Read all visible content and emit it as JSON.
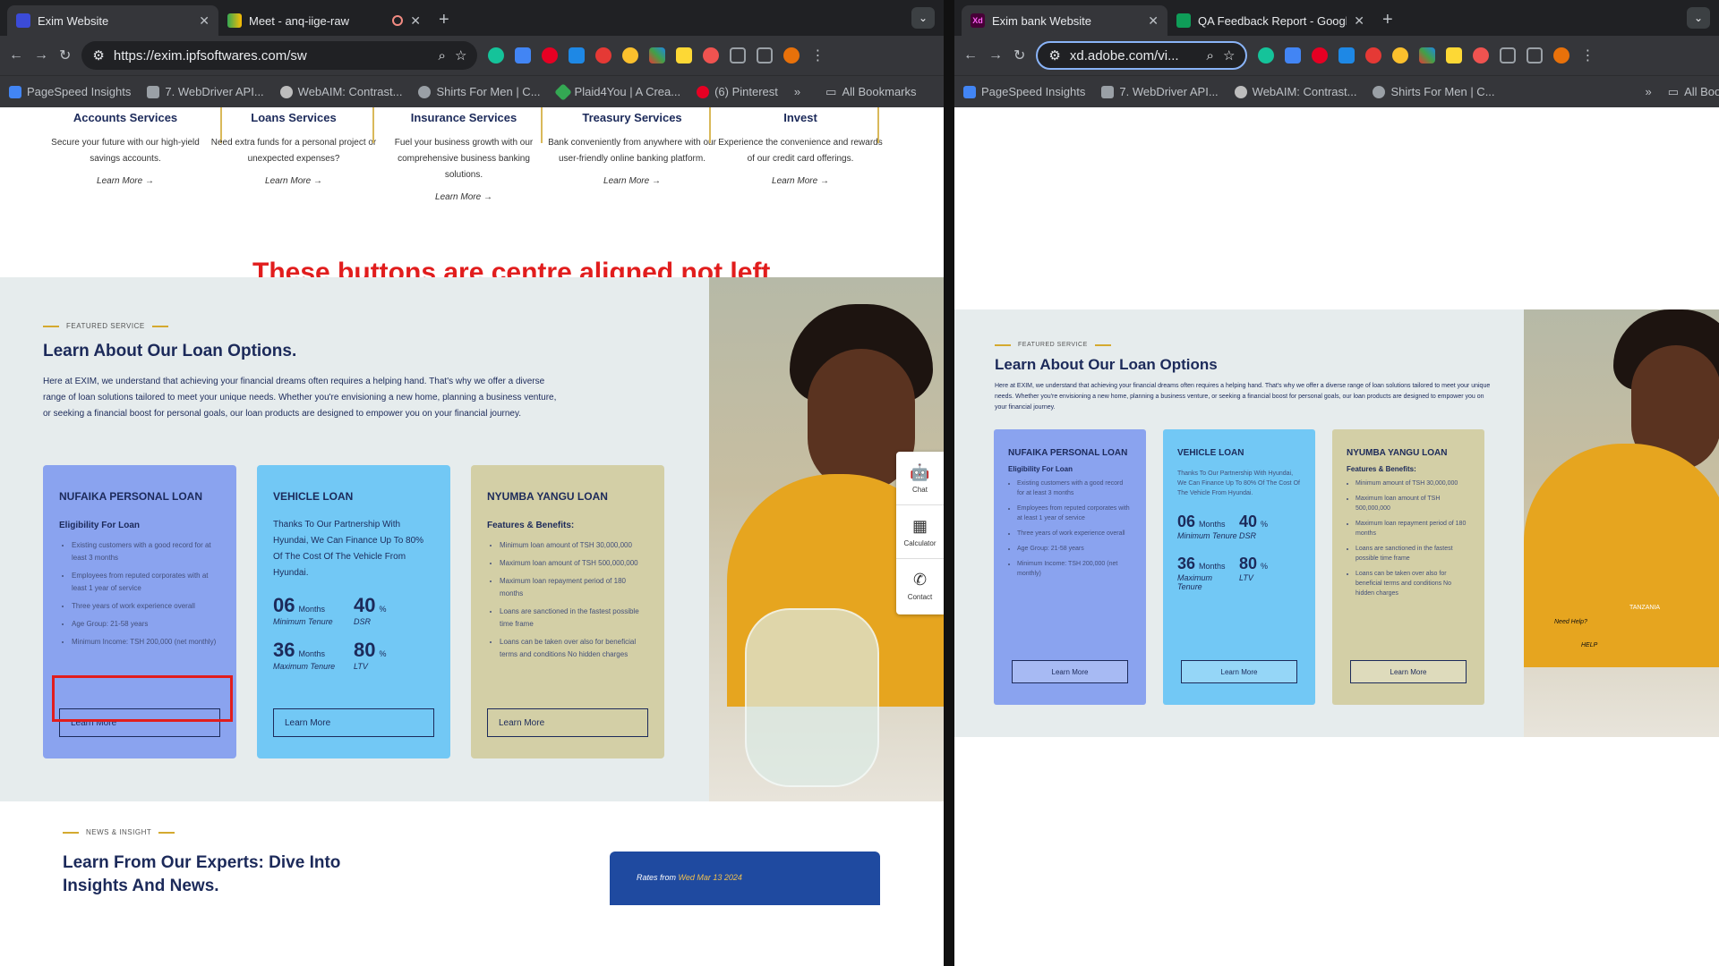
{
  "left_window": {
    "tabs": [
      {
        "title": "Exim Website",
        "active": true
      },
      {
        "title": "Meet - anq-iige-raw",
        "active": false
      }
    ],
    "url": "https://exim.ipfsoftwares.com/sw",
    "bookmarks": [
      "PageSpeed Insights",
      "7. WebDriver API...",
      "WebAIM: Contrast...",
      "Shirts For Men | C...",
      "Plaid4You | A Crea...",
      "(6) Pinterest"
    ],
    "all_bookmarks": "All Bookmarks"
  },
  "right_window": {
    "tabs": [
      {
        "title": "Exim bank Website",
        "active": true
      },
      {
        "title": "QA Feedback Report - Google",
        "active": false
      }
    ],
    "url": "xd.adobe.com/vi...",
    "bookmarks": [
      "PageSpeed Insights",
      "7. WebDriver API...",
      "WebAIM: Contrast...",
      "Shirts For Men | C..."
    ],
    "all_bookmarks": "All Bookmarks"
  },
  "services": [
    {
      "title": "Accounts Services",
      "desc": "Secure your future with our high-yield savings accounts.",
      "link": "Learn More"
    },
    {
      "title": "Loans Services",
      "desc": "Need extra funds for a personal project or unexpected expenses?",
      "link": "Learn More"
    },
    {
      "title": "Insurance Services",
      "desc": "Fuel your business growth with our comprehensive business banking solutions.",
      "link": "Learn More"
    },
    {
      "title": "Treasury Services",
      "desc": "Bank conveniently from anywhere with our user-friendly online banking platform.",
      "link": "Learn More"
    },
    {
      "title": "Invest",
      "desc": "Experience the convenience and rewards of our credit card offerings.",
      "link": "Learn More"
    }
  ],
  "annotation": "These buttons are centre aligned not left",
  "loan_section": {
    "eyebrow": "FEATURED SERVICE",
    "title": "Learn About Our Loan Options.",
    "desc": "Here at EXIM, we understand that achieving your financial dreams often requires a helping hand. That's why we offer a diverse range of loan solutions tailored to meet your unique needs. Whether you're envisioning a new home, planning a business venture, or seeking a financial boost for personal goals, our loan products are designed to empower you on your financial journey.",
    "cards": [
      {
        "title": "NUFAIKA PERSONAL LOAN",
        "subtitle": "Eligibility For Loan",
        "items": [
          "Existing customers with a good record for at least 3 months",
          "Employees from reputed corporates with at least 1 year of service",
          "Three years of work experience overall",
          "Age Group: 21-58 years",
          "Minimum Income: TSH 200,000 (net monthly)"
        ],
        "button": "Learn More"
      },
      {
        "title": "VEHICLE LOAN",
        "body": "Thanks To Our Partnership With Hyundai, We Can Finance Up To 80% Of The Cost Of The Vehicle From Hyundai.",
        "stats": [
          {
            "value": "06",
            "unit": "Months",
            "caption": "Minimum Tenure"
          },
          {
            "value": "40",
            "unit": "%",
            "caption": "DSR"
          },
          {
            "value": "36",
            "unit": "Months",
            "caption": "Maximum Tenure"
          },
          {
            "value": "80",
            "unit": "%",
            "caption": "LTV"
          }
        ],
        "button": "Learn More"
      },
      {
        "title": "NYUMBA YANGU LOAN",
        "subtitle": "Features & Benefits:",
        "items": [
          "Minimum loan amount of TSH 30,000,000",
          "Maximum loan amount of TSH 500,000,000",
          "Maximum loan repayment period of 180 months",
          "Loans are sanctioned in the fastest possible time frame",
          "Loans can be taken over also for beneficial terms and conditions No hidden charges"
        ],
        "button": "Learn More"
      }
    ]
  },
  "widget": {
    "chat": "Chat",
    "calculator": "Calculator",
    "contact": "Contact"
  },
  "news": {
    "eyebrow": "NEWS & INSIGHT",
    "title": "Learn From Our Experts: Dive Into Insights And News.",
    "rates_label": "Rates from",
    "rates_date": "Wed Mar 13 2024"
  },
  "xd": {
    "eyebrow": "FEATURED SERVICE",
    "title": "Learn About Our Loan Options",
    "desc": "Here at EXIM, we understand that achieving your financial dreams often requires a helping hand. That's why we offer a diverse range of loan solutions tailored to meet your unique needs. Whether you're envisioning a new home, planning a business venture, or seeking a financial boost for personal goals, our loan products are designed to empower you on your financial journey.",
    "cards": [
      {
        "title": "NUFAIKA PERSONAL LOAN",
        "subtitle": "Eligibility For Loan",
        "items": [
          "Existing customers with a good record for at least 3 months",
          "Employees from reputed corporates with at least 1 year of service",
          "Three years of work experience overall",
          "Age Group: 21-58 years",
          "Minimum Income: TSH 200,000 (net monthly)"
        ],
        "button": "Learn More"
      },
      {
        "title": "VEHICLE LOAN",
        "body": "Thanks To Our Partnership With Hyundai, We Can Finance Up To 80% Of The Cost Of The Vehicle From Hyundai.",
        "stats": [
          {
            "value": "06",
            "unit": "Months",
            "caption": "Minimum Tenure"
          },
          {
            "value": "40",
            "unit": "%",
            "caption": "DSR"
          },
          {
            "value": "36",
            "unit": "Months",
            "caption": "Maximum Tenure"
          },
          {
            "value": "80",
            "unit": "%",
            "caption": "LTV"
          }
        ],
        "button": "Learn More"
      },
      {
        "title": "NYUMBA YANGU LOAN",
        "subtitle": "Features & Benefits:",
        "items": [
          "Minimum amount of TSH 30,000,000",
          "Maximum loan amount of TSH 500,000,000",
          "Maximum loan repayment period of 180 months",
          "Loans are sanctioned in the fastest possible time frame",
          "Loans can be taken over also for beneficial terms and conditions No hidden charges"
        ],
        "button": "Learn More"
      }
    ],
    "need_help": "Need Help?",
    "help": "HELP",
    "region": "TANZANIA"
  },
  "colors": {
    "card_personal": "#8aa3ef",
    "card_vehicle": "#72c8f5",
    "card_nyumba": "#d3cfa6",
    "navy": "#1c2a5a",
    "annotation_red": "#e11d1d"
  }
}
